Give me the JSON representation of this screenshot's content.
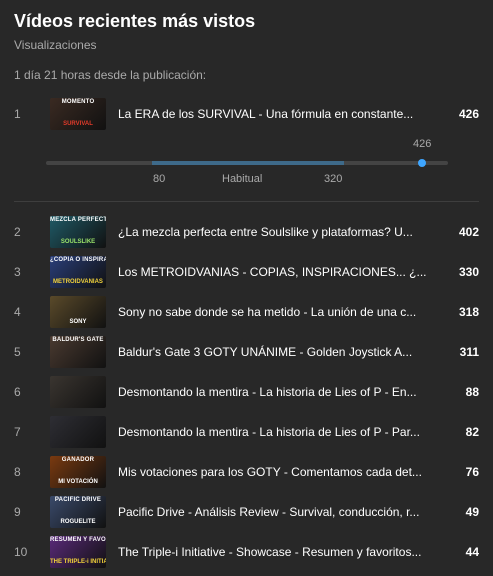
{
  "header": {
    "title": "Vídeos recientes más vistos",
    "subtitle": "Visualizaciones",
    "timeframe": "1 día 21 horas desde la publicación:"
  },
  "range": {
    "current": "426",
    "low": "80",
    "label": "Habitual",
    "high": "320",
    "current_value": 426,
    "scale_max": 450
  },
  "videos": [
    {
      "rank": "1",
      "title": "La ERA de los SURVIVAL - Una fórmula en constante...",
      "views": "426",
      "thumb_text_top": "MOMENTO",
      "thumb_text_bottom": "SURVIVAL",
      "thumb_color": "#3a2a22"
    },
    {
      "rank": "2",
      "title": "¿La mezcla perfecta entre Soulslike y plataformas? U...",
      "views": "402",
      "thumb_text_top": "MEZCLA PERFECTA",
      "thumb_text_bottom": "SOULSLIKE",
      "thumb_color": "#1f5a66"
    },
    {
      "rank": "3",
      "title": "Los METROIDVANIAS - COPIAS, INSPIRACIONES... ¿...",
      "views": "330",
      "thumb_text_top": "¿COPIA O INSPIRACIÓN?",
      "thumb_text_bottom": "METROIDVANIAS",
      "thumb_color": "#2a3e7a"
    },
    {
      "rank": "4",
      "title": "Sony no sabe donde se ha metido - La unión de una c...",
      "views": "318",
      "thumb_text_top": "",
      "thumb_text_bottom": "SONY",
      "thumb_color": "#5a4a2a"
    },
    {
      "rank": "5",
      "title": "Baldur's Gate 3 GOTY UNÁNIME - Golden Joystick A...",
      "views": "311",
      "thumb_text_top": "BALDUR'S GATE",
      "thumb_text_bottom": "",
      "thumb_color": "#4a3a30"
    },
    {
      "rank": "6",
      "title": "Desmontando la mentira - La historia de Lies of P - En...",
      "views": "88",
      "thumb_text_top": "",
      "thumb_text_bottom": "",
      "thumb_color": "#3a3530"
    },
    {
      "rank": "7",
      "title": "Desmontando la mentira - La historia de Lies of P - Par...",
      "views": "82",
      "thumb_text_top": "",
      "thumb_text_bottom": "",
      "thumb_color": "#2e2e34"
    },
    {
      "rank": "8",
      "title": "Mis votaciones para los GOTY - Comentamos cada det...",
      "views": "76",
      "thumb_text_top": "GANADOR",
      "thumb_text_bottom": "MI VOTACIÓN",
      "thumb_color": "#7a3a10"
    },
    {
      "rank": "9",
      "title": "Pacific Drive - Análisis Review - Survival, conducción, r...",
      "views": "49",
      "thumb_text_top": "PACIFIC DRIVE",
      "thumb_text_bottom": "ROGUELITE",
      "thumb_color": "#3a4a6a"
    },
    {
      "rank": "10",
      "title": "The Triple-i Initiative - Showcase - Resumen y favoritos...",
      "views": "44",
      "thumb_text_top": "RESUMEN Y FAVORITOS",
      "thumb_text_bottom": "THE TRIPLE-i INITIATIVE",
      "thumb_color": "#5a2a7a"
    }
  ]
}
